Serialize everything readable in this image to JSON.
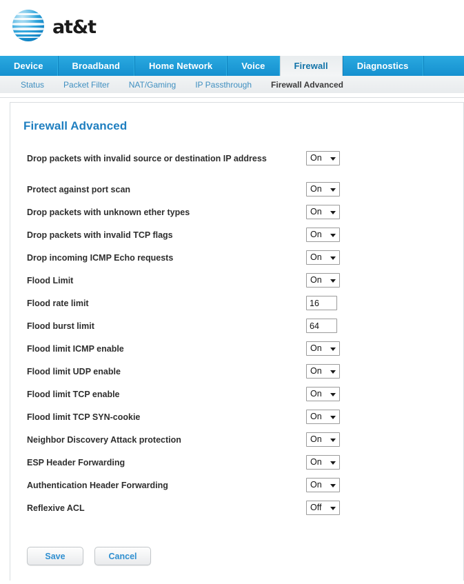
{
  "brand": {
    "logo_icon": "att-globe-icon",
    "wordmark": "at&t"
  },
  "main_nav": {
    "items": [
      {
        "label": "Device",
        "active": false
      },
      {
        "label": "Broadband",
        "active": false
      },
      {
        "label": "Home Network",
        "active": false
      },
      {
        "label": "Voice",
        "active": false
      },
      {
        "label": "Firewall",
        "active": true
      },
      {
        "label": "Diagnostics",
        "active": false
      }
    ]
  },
  "sub_nav": {
    "items": [
      {
        "label": "Status",
        "active": false
      },
      {
        "label": "Packet Filter",
        "active": false
      },
      {
        "label": "NAT/Gaming",
        "active": false
      },
      {
        "label": "IP Passthrough",
        "active": false
      },
      {
        "label": "Firewall Advanced",
        "active": true
      }
    ]
  },
  "page": {
    "title": "Firewall Advanced"
  },
  "settings": {
    "rows": [
      {
        "label": "Drop packets with invalid source or destination IP address",
        "type": "select",
        "value": "On",
        "options": [
          "On",
          "Off"
        ]
      },
      {
        "label": "Protect against port scan",
        "type": "select",
        "value": "On",
        "options": [
          "On",
          "Off"
        ]
      },
      {
        "label": "Drop packets with unknown ether types",
        "type": "select",
        "value": "On",
        "options": [
          "On",
          "Off"
        ]
      },
      {
        "label": "Drop packets with invalid TCP flags",
        "type": "select",
        "value": "On",
        "options": [
          "On",
          "Off"
        ]
      },
      {
        "label": "Drop incoming ICMP Echo requests",
        "type": "select",
        "value": "On",
        "options": [
          "On",
          "Off"
        ]
      },
      {
        "label": "Flood Limit",
        "type": "select",
        "value": "On",
        "options": [
          "On",
          "Off"
        ]
      },
      {
        "label": "Flood rate limit",
        "type": "text",
        "value": "16"
      },
      {
        "label": "Flood burst limit",
        "type": "text",
        "value": "64"
      },
      {
        "label": "Flood limit ICMP enable",
        "type": "select",
        "value": "On",
        "options": [
          "On",
          "Off"
        ]
      },
      {
        "label": "Flood limit UDP enable",
        "type": "select",
        "value": "On",
        "options": [
          "On",
          "Off"
        ]
      },
      {
        "label": "Flood limit TCP enable",
        "type": "select",
        "value": "On",
        "options": [
          "On",
          "Off"
        ]
      },
      {
        "label": "Flood limit TCP SYN-cookie",
        "type": "select",
        "value": "On",
        "options": [
          "On",
          "Off"
        ]
      },
      {
        "label": "Neighbor Discovery Attack protection",
        "type": "select",
        "value": "On",
        "options": [
          "On",
          "Off"
        ]
      },
      {
        "label": "ESP Header Forwarding",
        "type": "select",
        "value": "On",
        "options": [
          "On",
          "Off"
        ]
      },
      {
        "label": "Authentication Header Forwarding",
        "type": "select",
        "value": "On",
        "options": [
          "On",
          "Off"
        ]
      },
      {
        "label": "Reflexive ACL",
        "type": "select",
        "value": "Off",
        "options": [
          "On",
          "Off"
        ]
      }
    ]
  },
  "actions": {
    "save_label": "Save",
    "cancel_label": "Cancel"
  },
  "colors": {
    "nav_blue": "#1b9ad6",
    "title_blue": "#1f7fc0",
    "link_blue": "#3f8fc0",
    "button_text_blue": "#2f8fd0"
  }
}
